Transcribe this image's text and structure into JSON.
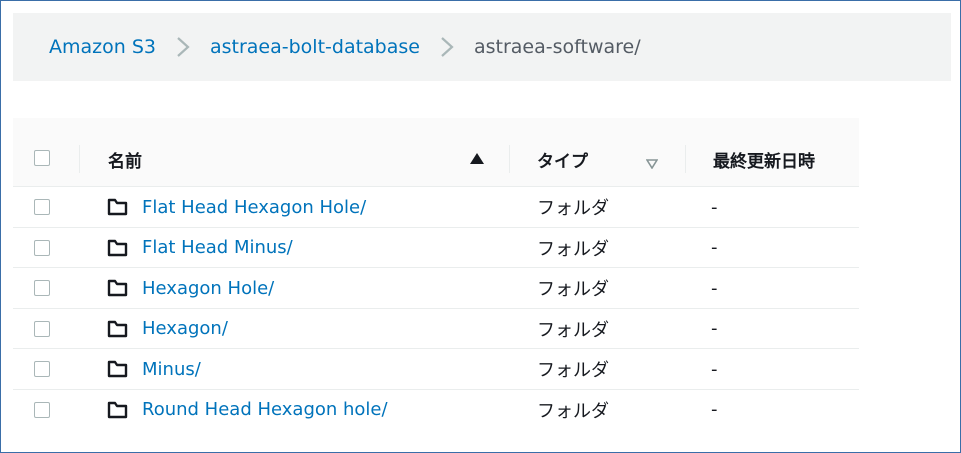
{
  "breadcrumb": {
    "items": [
      "Amazon S3",
      "astraea-bolt-database"
    ],
    "current": "astraea-software/"
  },
  "table": {
    "columns": {
      "name": "名前",
      "type": "タイプ",
      "modified": "最終更新日時"
    },
    "rows": [
      {
        "name": "Flat Head Hexagon Hole/",
        "type": "フォルダ",
        "modified": "-"
      },
      {
        "name": "Flat Head Minus/",
        "type": "フォルダ",
        "modified": "-"
      },
      {
        "name": "Hexagon Hole/",
        "type": "フォルダ",
        "modified": "-"
      },
      {
        "name": "Hexagon/",
        "type": "フォルダ",
        "modified": "-"
      },
      {
        "name": "Minus/",
        "type": "フォルダ",
        "modified": "-"
      },
      {
        "name": "Round Head Hexagon hole/",
        "type": "フォルダ",
        "modified": "-"
      }
    ]
  },
  "icons": {
    "folder": "folder-icon",
    "separator": "chevron-right-icon",
    "sort_name": "sort-ascending-icon",
    "sort_type": "sort-descending-icon"
  },
  "colors": {
    "link": "#0073bb",
    "text": "#16191f",
    "muted": "#545b64",
    "breadcrumb_bg": "#f2f3f3",
    "border": "#3a6ea8"
  }
}
